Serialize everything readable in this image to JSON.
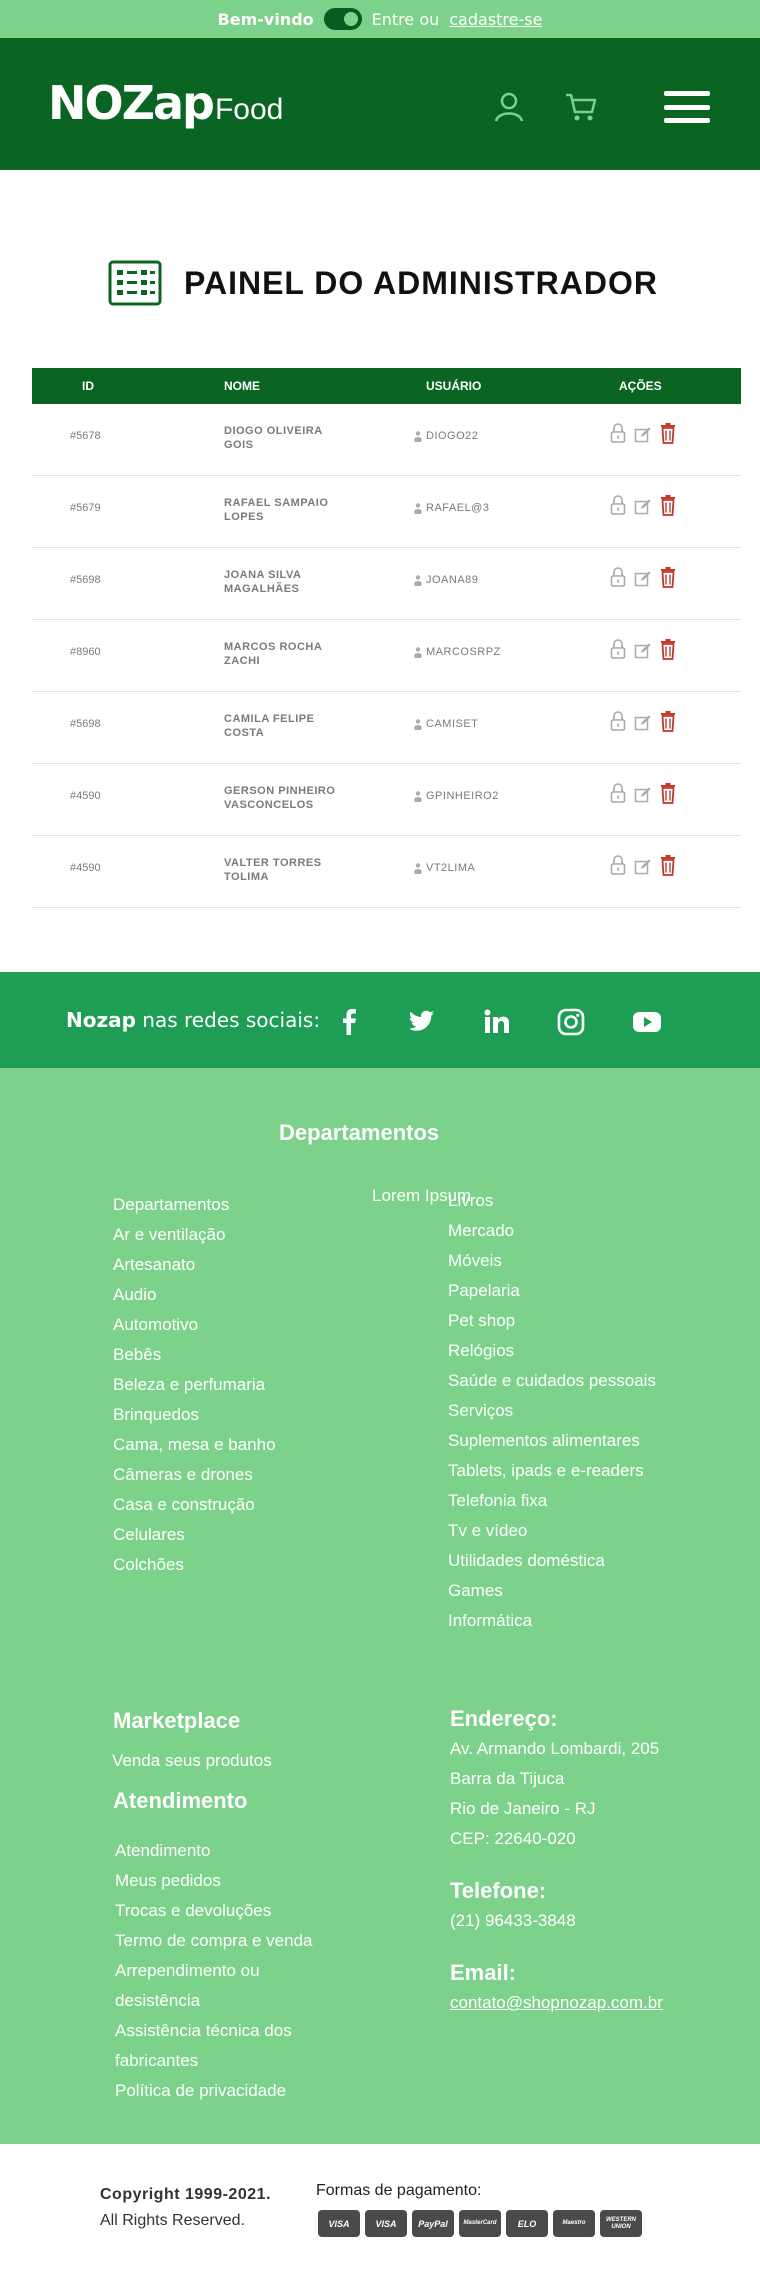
{
  "topbar": {
    "welcome": "Bem-vindo",
    "enter": "Entre ou",
    "signup": "cadastre-se"
  },
  "header": {
    "logo_main": "NOZap",
    "logo_sub": "Food"
  },
  "panel": {
    "title": "PAINEL DO ADMINISTRADOR"
  },
  "table": {
    "headers": {
      "id": "ID",
      "name": "NOME",
      "user": "USUÁRIO",
      "actions": "AÇÕES"
    },
    "rows": [
      {
        "id": "#5678",
        "name": "DIOGO OLIVEIRA GOIS",
        "user": "DIOGO22"
      },
      {
        "id": "#5679",
        "name": "RAFAEL SAMPAIO LOPES",
        "user": "RAFAEL@3"
      },
      {
        "id": "#5698",
        "name": "JOANA SILVA MAGALHÃES",
        "user": "JOANA89"
      },
      {
        "id": "#8960",
        "name": "MARCOS ROCHA ZACHI",
        "user": "MARCOSRPZ"
      },
      {
        "id": "#5698",
        "name": "CAMILA FELIPE COSTA",
        "user": "CAMISET"
      },
      {
        "id": "#4590",
        "name": "GERSON PINHEIRO VASCONCELOS",
        "user": "GPINHEIRO2"
      },
      {
        "id": "#4590",
        "name": "VALTER TORRES TOLIMA",
        "user": "VT2LIMA"
      }
    ]
  },
  "social": {
    "brand": "Nozap",
    "label": "nas redes sociais:"
  },
  "footer": {
    "departments_title": "Departamentos",
    "lorem": "Lorem Ipsum",
    "col1": [
      "Departamentos",
      "Ar e ventilação",
      "Artesanato",
      "Audio",
      "Automotivo",
      "Bebês",
      "Beleza e perfumaria",
      "Brinquedos",
      "Cama, mesa e banho",
      "Câmeras e drones",
      "Casa e construção",
      "Celulares",
      "Colchões"
    ],
    "col2": [
      "Livros",
      "Mercado",
      "Móveis",
      "Papelaria",
      "Pet shop",
      "Relógios",
      "Saúde e cuidados pessoais",
      "Serviços",
      "Suplementos alimentares",
      "Tablets, ipads e e-readers",
      "Telefonia fixa",
      "Tv e vídeo",
      "Utilidades doméstica",
      "Games",
      "Informática"
    ],
    "marketplace_title": "Marketplace",
    "marketplace_link": "Venda seus produtos",
    "service_title": "Atendimento",
    "service_links": [
      "Atendimento",
      "Meus pedidos",
      "Trocas e devoluções",
      "Termo de compra e venda",
      "Arrependimento ou",
      "desistência",
      "Assistência técnica dos",
      "fabricantes",
      "Política de privacidade"
    ],
    "address_title": "Endereço:",
    "address_lines": [
      "Av. Armando Lombardi, 205",
      "Barra da Tijuca",
      "Rio de Janeiro - RJ",
      "CEP: 22640-020"
    ],
    "phone_title": "Telefone:",
    "phone": "(21) 96433-3848",
    "email_title": "Email:",
    "email": "contato@shopnozap.com.br"
  },
  "bottom": {
    "copyright": "Copyright 1999-2021.",
    "rights": "All Rights Reserved.",
    "payment_label": "Formas de pagamento:",
    "cards": [
      "VISA",
      "VISA",
      "PayPal",
      "MasterCard",
      "ELO",
      "Maestro",
      "WESTERN UNION"
    ]
  }
}
